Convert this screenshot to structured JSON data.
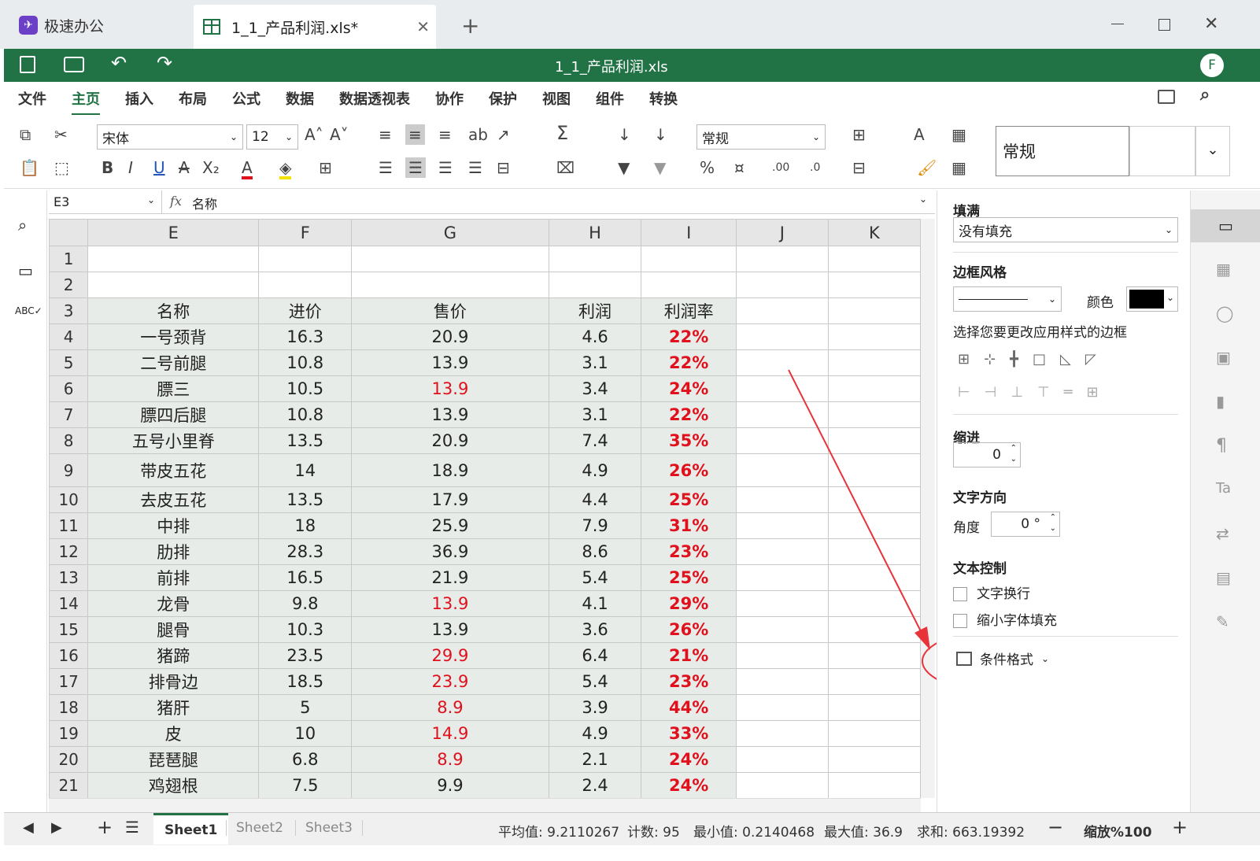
{
  "app": {
    "name": "极速办公",
    "tab_title": "1_1_产品利润.xls*",
    "file_title": "1_1_产品利润.xls",
    "user_initial": "F"
  },
  "menu": [
    "文件",
    "主页",
    "插入",
    "布局",
    "公式",
    "数据",
    "数据透视表",
    "协作",
    "保护",
    "视图",
    "组件",
    "转换"
  ],
  "toolbar": {
    "font_name": "宋体",
    "font_size": "12",
    "number_format": "常规",
    "style_box": "常规"
  },
  "formula": {
    "cell_ref": "E3",
    "fx": "fx",
    "content": "名称"
  },
  "columns": [
    "E",
    "F",
    "G",
    "H",
    "I",
    "J",
    "K"
  ],
  "headers": [
    "名称",
    "进价",
    "售价",
    "利润",
    "利润率"
  ],
  "rows": [
    {
      "n": "1",
      "c": [
        "",
        "",
        "",
        "",
        ""
      ]
    },
    {
      "n": "2",
      "c": [
        "",
        "",
        "",
        "",
        ""
      ]
    },
    {
      "n": "3",
      "c": [
        "名称",
        "进价",
        "售价",
        "利润",
        "利润率"
      ]
    },
    {
      "n": "4",
      "c": [
        "一号颈背",
        "16.3",
        "20.9",
        "4.6",
        "22%"
      ],
      "red": false
    },
    {
      "n": "5",
      "c": [
        "二号前腿",
        "10.8",
        "13.9",
        "3.1",
        "22%"
      ],
      "red": false
    },
    {
      "n": "6",
      "c": [
        "膘三",
        "10.5",
        "13.9",
        "3.4",
        "24%"
      ],
      "red": true
    },
    {
      "n": "7",
      "c": [
        "膘四后腿",
        "10.8",
        "13.9",
        "3.1",
        "22%"
      ],
      "red": false
    },
    {
      "n": "8",
      "c": [
        "五号小里脊",
        "13.5",
        "20.9",
        "7.4",
        "35%"
      ],
      "red": false
    },
    {
      "n": "9",
      "c": [
        "带皮五花",
        "14",
        "18.9",
        "4.9",
        "26%"
      ],
      "red": false
    },
    {
      "n": "10",
      "c": [
        "去皮五花",
        "13.5",
        "17.9",
        "4.4",
        "25%"
      ],
      "red": false
    },
    {
      "n": "11",
      "c": [
        "中排",
        "18",
        "25.9",
        "7.9",
        "31%"
      ],
      "red": false
    },
    {
      "n": "12",
      "c": [
        "肋排",
        "28.3",
        "36.9",
        "8.6",
        "23%"
      ],
      "red": false
    },
    {
      "n": "13",
      "c": [
        "前排",
        "16.5",
        "21.9",
        "5.4",
        "25%"
      ],
      "red": false
    },
    {
      "n": "14",
      "c": [
        "龙骨",
        "9.8",
        "13.9",
        "4.1",
        "29%"
      ],
      "red": true
    },
    {
      "n": "15",
      "c": [
        "腿骨",
        "10.3",
        "13.9",
        "3.6",
        "26%"
      ],
      "red": false
    },
    {
      "n": "16",
      "c": [
        "猪蹄",
        "23.5",
        "29.9",
        "6.4",
        "21%"
      ],
      "red": true
    },
    {
      "n": "17",
      "c": [
        "排骨边",
        "18.5",
        "23.9",
        "5.4",
        "23%"
      ],
      "red": true
    },
    {
      "n": "18",
      "c": [
        "猪肝",
        "5",
        "8.9",
        "3.9",
        "44%"
      ],
      "red": true
    },
    {
      "n": "19",
      "c": [
        "皮",
        "10",
        "14.9",
        "4.9",
        "33%"
      ],
      "red": true
    },
    {
      "n": "20",
      "c": [
        "琵琶腿",
        "6.8",
        "8.9",
        "2.1",
        "24%"
      ],
      "red": true
    },
    {
      "n": "21",
      "c": [
        "鸡翅根",
        "7.5",
        "9.9",
        "2.4",
        "24%"
      ],
      "red": false
    }
  ],
  "panel": {
    "fill_title": "填满",
    "fill_value": "没有填充",
    "border_title": "边框风格",
    "color_label": "颜色",
    "border_hint": "选择您要更改应用样式的边框",
    "indent_title": "缩进",
    "indent_value": "0",
    "direction_title": "文字方向",
    "angle_label": "角度",
    "angle_value": "0 °",
    "control_title": "文本控制",
    "wrap_label": "文字换行",
    "shrink_label": "缩小字体填充",
    "cond_format": "条件格式"
  },
  "sheets": [
    "Sheet1",
    "Sheet2",
    "Sheet3"
  ],
  "status": {
    "avg": "平均值: 9.2110267",
    "count": "计数: 95",
    "min": "最小值: 0.2140468",
    "max": "最大值: 36.9",
    "sum": "求和: 663.19392",
    "zoom": "缩放%100"
  },
  "colors": {
    "brand_green": "#217346",
    "red": "#e0101c",
    "annotation": "#e8333a"
  }
}
